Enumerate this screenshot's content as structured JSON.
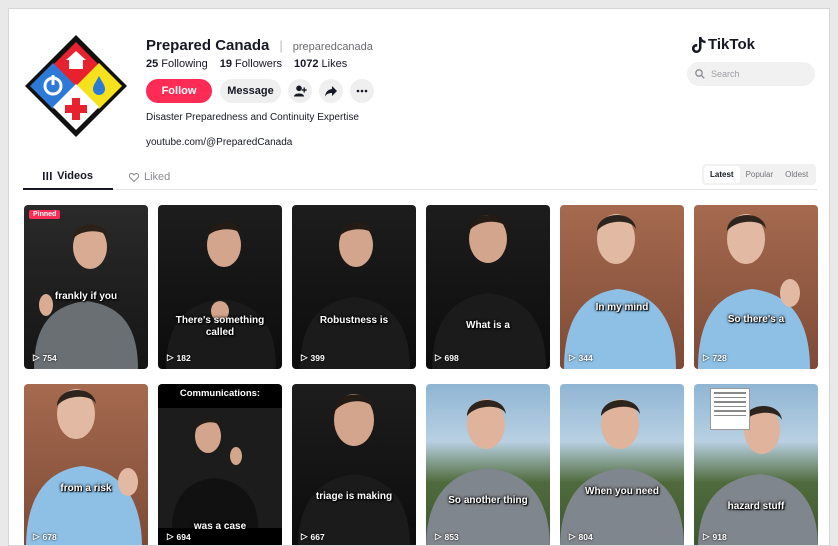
{
  "profile": {
    "display_name": "Prepared Canada",
    "handle": "preparedcanada",
    "following_count": "25",
    "following_label": "Following",
    "followers_count": "19",
    "followers_label": "Followers",
    "likes_count": "1072",
    "likes_label": "Likes",
    "bio": "Disaster Preparedness and Continuity Expertise",
    "link": "youtube.com/@PreparedCanada"
  },
  "actions": {
    "follow_label": "Follow",
    "message_label": "Message",
    "icons": [
      "add-friend-icon",
      "share-icon",
      "more-icon"
    ]
  },
  "brand": {
    "name": "TikTok"
  },
  "search": {
    "placeholder": "Search"
  },
  "tabs": {
    "videos": "Videos",
    "liked": "Liked"
  },
  "sort": {
    "latest": "Latest",
    "popular": "Popular",
    "oldest": "Oldest",
    "active": "latest"
  },
  "colors": {
    "accent": "#fe2c55",
    "text": "#161823",
    "muted": "#8a8b91"
  },
  "videos": [
    {
      "caption": "frankly if you",
      "views": "754",
      "badge": "Pinned"
    },
    {
      "caption": "There's something called",
      "views": "182"
    },
    {
      "caption": "Robustness is",
      "views": "399"
    },
    {
      "caption": "What is a",
      "views": "698"
    },
    {
      "caption": "In my mind",
      "views": "344"
    },
    {
      "caption": "So there's a",
      "views": "728"
    },
    {
      "caption": "from a risk",
      "views": "678"
    },
    {
      "caption": "was a case",
      "views": "694",
      "top_caption": "Communications:"
    },
    {
      "caption": "triage is making",
      "views": "667"
    },
    {
      "caption": "So another thing",
      "views": "853"
    },
    {
      "caption": "When you need",
      "views": "804"
    },
    {
      "caption": "hazard stuff",
      "views": "918"
    }
  ]
}
